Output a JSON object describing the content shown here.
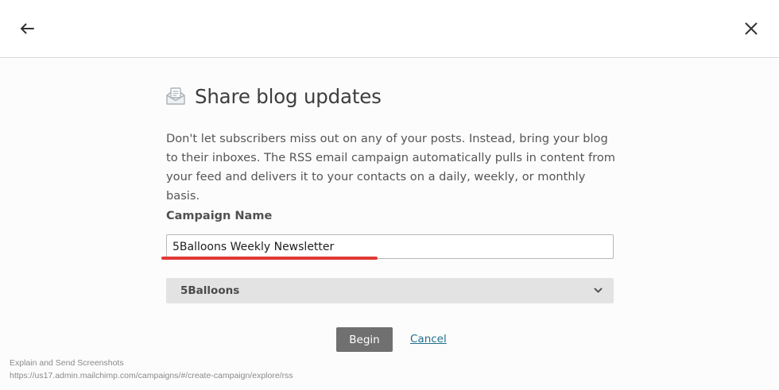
{
  "header": {
    "back_icon": "arrow-left-icon",
    "close_icon": "close-icon"
  },
  "main": {
    "icon": "envelope-document-icon",
    "title": "Share blog updates",
    "description": "Don't let subscribers miss out on any of your posts. Instead, bring your blog to their inboxes. The RSS email campaign automatically pulls in content from your feed and delivers it to your contacts on a daily, weekly, or monthly basis.",
    "campaign_name_label": "Campaign Name",
    "campaign_name_value": "5Balloons Weekly Newsletter",
    "audience_select_value": "5Balloons",
    "begin_label": "Begin",
    "cancel_label": "Cancel"
  },
  "colors": {
    "annotation_underline": "#e03a36",
    "begin_button": "#707070",
    "cancel_link": "#1f6f8a",
    "select_background": "#e3e3e3"
  },
  "overlay": {
    "line1": "Explain and Send Screenshots",
    "line2": "https://us17.admin.mailchimp.com/campaigns/#/create-campaign/explore/rss"
  }
}
